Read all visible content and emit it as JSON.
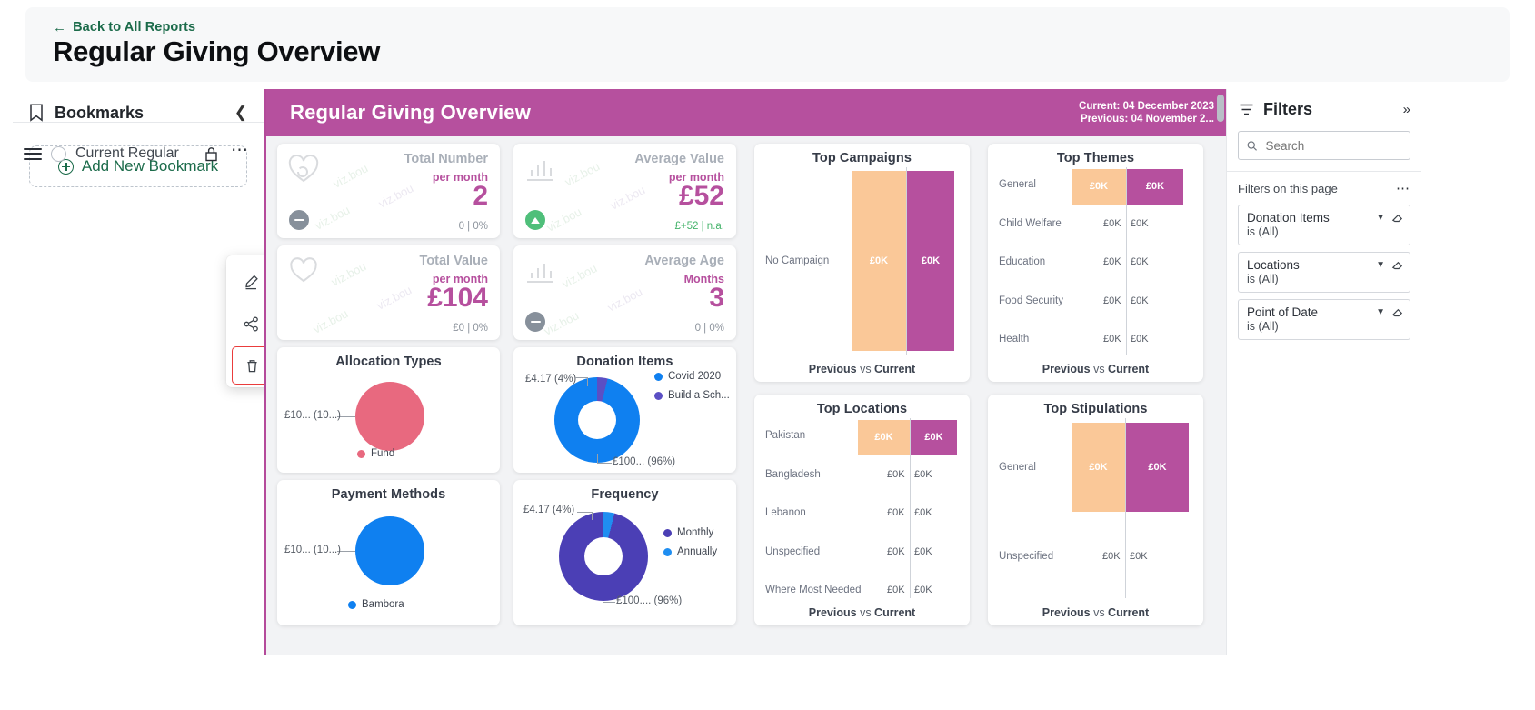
{
  "header": {
    "back_label": "Back to All Reports",
    "back_icon": "arrow-left-icon",
    "title": "Regular Giving Overview"
  },
  "bookmarks_panel": {
    "icon": "bookmark-icon",
    "title": "Bookmarks",
    "collapse_icon": "chevron-left-icon",
    "add_label": "Add New Bookmark",
    "items": [
      {
        "name": "Current Regular",
        "handle_icon": "drag-handle-icon",
        "radio_icon": "radio-unchecked-icon",
        "lock_icon": "lock-icon",
        "more_icon": "ellipsis-icon"
      }
    ]
  },
  "context_menu": {
    "items": [
      {
        "label": "Edit",
        "icon": "pencil-icon",
        "highlighted": false
      },
      {
        "label": "Share",
        "icon": "share-icon",
        "highlighted": false
      },
      {
        "label": "Delete",
        "icon": "trash-icon",
        "highlighted": true
      }
    ],
    "highlight_color": "#ea3c3c"
  },
  "report": {
    "bar_title": "Regular Giving Overview",
    "current_label": "Current:",
    "current_date": "04 December 2023",
    "previous_label": "Previous:",
    "previous_date": "04 November 2...",
    "accent_color": "#b6509e",
    "kpis": [
      {
        "label": "Total Number",
        "sub": "per month",
        "value": "2",
        "delta": "0 | 0%",
        "delta_tone": "neutral",
        "trend": "flat",
        "icon": "recurring-heart-icon"
      },
      {
        "label": "Average Value",
        "sub": "per month",
        "value": "£52",
        "delta": "£+52 |  n.a.",
        "delta_tone": "positive",
        "trend": "up",
        "icon": "bar-growth-icon"
      },
      {
        "label": "Total Value",
        "sub": "per month",
        "value": "£104",
        "delta": "£0 | 0%",
        "delta_tone": "neutral",
        "trend": "flat",
        "icon": "heart-coin-icon"
      },
      {
        "label": "Average Age",
        "sub": "Months",
        "value": "3",
        "delta": "0 | 0%",
        "delta_tone": "neutral",
        "trend": "flat",
        "icon": "bar-chart-icon"
      }
    ],
    "watermark_text": "viz.bou",
    "footer_prev": "Previous",
    "footer_vs": " vs ",
    "footer_cur": "Current"
  },
  "filters_panel": {
    "icon": "filter-icon",
    "title": "Filters",
    "expand_icon": "chevrons-right-icon",
    "search_icon": "search-icon",
    "search_placeholder": "Search",
    "search_value": "",
    "section_label": "Filters on this page",
    "section_more_icon": "ellipsis-icon",
    "filters": [
      {
        "name": "Donation Items",
        "state": "is (All)",
        "chevron_icon": "chevron-down-icon",
        "clear_icon": "eraser-icon"
      },
      {
        "name": "Locations",
        "state": "is (All)",
        "chevron_icon": "chevron-down-icon",
        "clear_icon": "eraser-icon"
      },
      {
        "name": "Point of Date",
        "state": "is (All)",
        "chevron_icon": "chevron-down-icon",
        "clear_icon": "eraser-icon"
      }
    ]
  },
  "chart_data": [
    {
      "type": "bar",
      "title": "Top Campaigns",
      "orientation": "horizontal-grouped",
      "categories": [
        "No Campaign"
      ],
      "series": [
        {
          "name": "Previous",
          "color": "#fac898",
          "values": [
            0
          ],
          "labels": [
            "£0K"
          ]
        },
        {
          "name": "Current",
          "color": "#b6509e",
          "values": [
            0
          ],
          "labels": [
            "£0K"
          ]
        }
      ],
      "footer": "Previous vs Current"
    },
    {
      "type": "bar",
      "title": "Top Themes",
      "orientation": "horizontal-grouped",
      "categories": [
        "General",
        "Child Welfare",
        "Education",
        "Food Security",
        "Health"
      ],
      "series": [
        {
          "name": "Previous",
          "color": "#fac898",
          "values": [
            0,
            0,
            0,
            0,
            0
          ],
          "labels": [
            "£0K",
            "£0K",
            "£0K",
            "£0K",
            "£0K"
          ]
        },
        {
          "name": "Current",
          "color": "#b6509e",
          "values": [
            0,
            0,
            0,
            0,
            0
          ],
          "labels": [
            "£0K",
            "£0K",
            "£0K",
            "£0K",
            "£0K"
          ]
        }
      ],
      "footer": "Previous vs Current"
    },
    {
      "type": "bar",
      "title": "Top Locations",
      "orientation": "horizontal-grouped",
      "categories": [
        "Pakistan",
        "Bangladesh",
        "Lebanon",
        "Unspecified",
        "Where Most Needed"
      ],
      "series": [
        {
          "name": "Previous",
          "color": "#fac898",
          "values": [
            0,
            0,
            0,
            0,
            0
          ],
          "labels": [
            "£0K",
            "£0K",
            "£0K",
            "£0K",
            "£0K"
          ]
        },
        {
          "name": "Current",
          "color": "#b6509e",
          "values": [
            0,
            0,
            0,
            0,
            0
          ],
          "labels": [
            "£0K",
            "£0K",
            "£0K",
            "£0K",
            "£0K"
          ]
        }
      ],
      "footer": "Previous vs Current"
    },
    {
      "type": "bar",
      "title": "Top Stipulations",
      "orientation": "horizontal-grouped",
      "categories": [
        "General",
        "Unspecified"
      ],
      "series": [
        {
          "name": "Previous",
          "color": "#fac898",
          "values": [
            0,
            0
          ],
          "labels": [
            "£0K",
            "£0K"
          ]
        },
        {
          "name": "Current",
          "color": "#b6509e",
          "values": [
            0,
            0
          ],
          "labels": [
            "£0K",
            "£0K"
          ]
        }
      ],
      "footer": "Previous vs Current"
    },
    {
      "type": "pie",
      "title": "Allocation Types",
      "labels": [
        "Fund"
      ],
      "values": [
        100
      ],
      "value_labels": [
        "£10... (10...)"
      ],
      "colors": [
        "#e8697f"
      ],
      "legend": [
        "Fund"
      ],
      "legend_position": "bottom"
    },
    {
      "type": "pie",
      "title": "Donation Items",
      "labels": [
        "Covid 2020",
        "Build a Sch..."
      ],
      "values": [
        96,
        4
      ],
      "value_labels": [
        "£100... (96%)",
        "£4.17 (4%)"
      ],
      "colors": [
        "#0f80f0",
        "#5b4fc4"
      ],
      "legend": [
        "Covid 2020",
        "Build a Sch..."
      ],
      "legend_position": "right"
    },
    {
      "type": "pie",
      "title": "Payment Methods",
      "labels": [
        "Bambora"
      ],
      "values": [
        100
      ],
      "value_labels": [
        "£10... (10...)"
      ],
      "colors": [
        "#0f80f0"
      ],
      "legend": [
        "Bambora"
      ],
      "legend_position": "bottom"
    },
    {
      "type": "pie",
      "title": "Frequency",
      "labels": [
        "Monthly",
        "Annually"
      ],
      "values": [
        96,
        4
      ],
      "value_labels": [
        "£100.... (96%)",
        "£4.17 (4%)"
      ],
      "colors": [
        "#4b3fb5",
        "#1f8ef1"
      ],
      "legend": [
        "Monthly",
        "Annually"
      ],
      "legend_position": "right"
    }
  ]
}
